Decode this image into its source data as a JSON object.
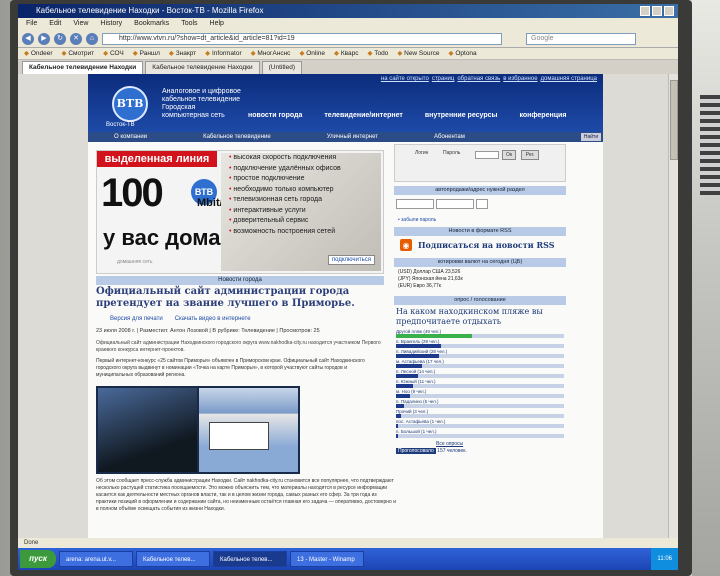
{
  "window": {
    "title": "Кабельное телевидение Находки - Восток-ТВ - Mozilla Firefox",
    "menu": [
      "File",
      "Edit",
      "View",
      "History",
      "Bookmarks",
      "Tools",
      "Help"
    ],
    "url": "http://www.vtvn.ru/?show=dt_article&id_article=81?id=19",
    "search_placeholder": "Google"
  },
  "bookmarks": [
    "Ondeer",
    "Смотрит",
    "СОЧ",
    "Раншл",
    "Знакрт",
    "Informator",
    "МногАнснс",
    "Online",
    "Кварс",
    "Todo",
    "New Source",
    "Optona"
  ],
  "tabs": [
    {
      "label": "Кабельное телевидение Находки",
      "active": true
    },
    {
      "label": "Кабельное телевидение Находки",
      "active": false
    },
    {
      "label": "(Untitled)",
      "active": false
    }
  ],
  "site": {
    "toplinks": [
      "на сайте открыто",
      "страниц",
      "обратная связь",
      "в избранное",
      "домашняя страница"
    ],
    "logo": "ВТВ",
    "logo_sub": "Восток-ТВ",
    "tagline": "Аналоговое и цифровое кабельное телевидение Городская компьютерная сеть",
    "hnav": [
      "новости города",
      "телевидение/интернет",
      "внутренние ресурсы",
      "конференция"
    ],
    "subnav": [
      "О компании",
      "Кабельное телевидение",
      "Уличный интернет",
      "Абонентам"
    ],
    "search_btn": "Найти"
  },
  "banner": {
    "head": "выделенная линия",
    "speed": "100",
    "unit": "Mbit/c",
    "home": "у вас дома!",
    "logo": "ВТВ",
    "foot": "домашняя сеть",
    "features": [
      "высокая скорость подключения",
      "подключение удалённых офисов",
      "простое подключение",
      "необходимо только компьютер",
      "телевизионная сеть города",
      "интерактивные услуги",
      "доверительный сервис",
      "возможность построения сетей"
    ],
    "more": "подключиться"
  },
  "article": {
    "section": "Новости города",
    "headline": "Официальный сайт администрации города претендует на звание лучшего в Приморье.",
    "links": [
      "Версия для печати",
      "Скачать видео в интернете"
    ],
    "meta": "23 июля 2008 г. | Разместил: Антон Лозовой | В рубрике: Телевидение | Просмотров: 25",
    "lead": "Официальный сайт администрации Находкинского городского округа www.nakhodka-city.ru находится участником Первого краевого конкурса интернет-проектов.",
    "para": "Первый интернет-конкурс «25 сайтов Приморья» объявлен в Приморском крае. Официальный сайт Находкинского городского округа выдвинут в номинации «Точка на карте Приморья», в которой участвуют сайты городов и муниципальных образований региона.",
    "tail": "Об этом сообщает пресс-служба администрации Находки. Сайт nakhodka-city.ru становится все популярнее, что подтверждают несколько растущей статистика посещаемости. Это можно объяснить тем, что материалы находятся в ресурсе информации касается как деятельности местных органов власти, так и в целом жизни города, самых разных его сфер. За три года из практики позиций в оформлении и содержании сайта, но неизменным остаётся главная его задача — оперативно, достоверно и в полном объёме освещать события из жизни Находки."
  },
  "sidebar": {
    "login_labels": [
      "Логин",
      "Пароль"
    ],
    "login_ok": "Ок",
    "login_reg": "Рег.",
    "address_label": "автопродажи/адрес нужной раздел",
    "address_note": "• забыли пароль",
    "rss_label": "Новости в формате RSS",
    "rss_title": "Подписаться на новости RSS",
    "rates_label": "котировки валют на сегодня (ЦБ)",
    "rates": [
      "(USD) Доллар США 23,526",
      "(JPY) Японская йена 21,63к",
      "(EUR) Евро 36,77к"
    ],
    "poll_label": "опрос / голосование",
    "poll_question": "На каком находкинском пляже вы предпочитаете отдыхать",
    "poll": [
      {
        "label": "Другой пляж (49 чел.)",
        "votes": 49
      },
      {
        "label": "п. Врангель (29 чел.)",
        "votes": 29
      },
      {
        "label": "п. Ливадийский (28 чел.)",
        "votes": 28
      },
      {
        "label": "м. Астафьева (17 чел.)",
        "votes": 17
      },
      {
        "label": "п. Лесной (14 чел.)",
        "votes": 14
      },
      {
        "label": "п. Южный (11 чел.)",
        "votes": 11
      },
      {
        "label": "м. Ноо (9 чел.)",
        "votes": 9
      },
      {
        "label": "п. Падалино (5 чел.)",
        "votes": 5
      },
      {
        "label": "Прочий (3 чел.)",
        "votes": 3
      },
      {
        "label": "пос. Астафьева (1 чел.)",
        "votes": 1
      },
      {
        "label": "п. Большой (1 чел.)",
        "votes": 1
      }
    ],
    "poll_vote": "Все опросы",
    "poll_total_label": "Проголосовало",
    "poll_total": "157 человек."
  },
  "statusbar": "Done",
  "taskbar": {
    "start": "пуск",
    "items": [
      {
        "label": "arena: arena.ut.v...",
        "active": false
      },
      {
        "label": "Кабельное телев...",
        "active": false
      },
      {
        "label": "Кабельное телев...",
        "active": true
      },
      {
        "label": "13 - Master - Winamp",
        "active": false
      }
    ],
    "clock": "11:06"
  }
}
